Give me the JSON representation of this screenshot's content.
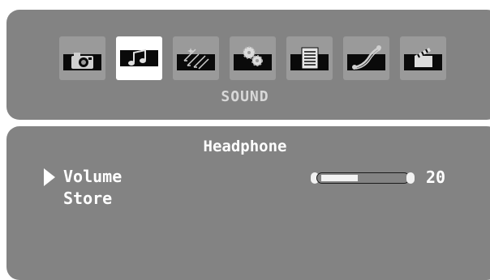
{
  "menu": {
    "tabs": [
      {
        "icon": "camera-icon",
        "selected": false
      },
      {
        "icon": "music-note-icon",
        "selected": true
      },
      {
        "icon": "sparkle-arrows-icon",
        "selected": false
      },
      {
        "icon": "gears-icon",
        "selected": false
      },
      {
        "icon": "document-icon",
        "selected": false
      },
      {
        "icon": "cable-icon",
        "selected": false
      },
      {
        "icon": "clapperboard-icon",
        "selected": false
      }
    ],
    "title": "SOUND"
  },
  "submenu": {
    "header": "Headphone",
    "items": [
      {
        "label": "Volume",
        "value": "20",
        "level": 0.2,
        "selected": true
      },
      {
        "label": "Store"
      }
    ]
  },
  "colors": {
    "panel": "#838383",
    "text": "#ffffff",
    "title": "#d8d8d8",
    "band": "#0a0a0a"
  }
}
